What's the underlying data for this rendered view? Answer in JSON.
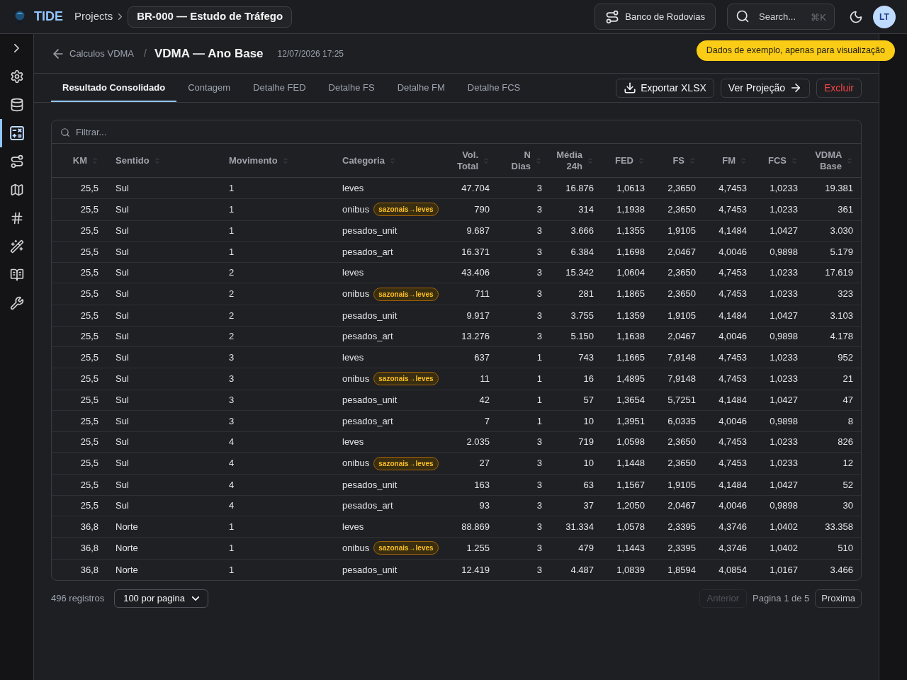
{
  "app": {
    "name": "TIDE"
  },
  "breadcrumb": {
    "root": "Projects",
    "project": "BR-000 — Estudo de Tráfego"
  },
  "top_actions": {
    "database_button": "Banco de Rodovias",
    "search": {
      "placeholder": "Search...",
      "shortcut": "⌘K"
    },
    "avatar": "LT"
  },
  "sidebar": {
    "items": [
      {
        "kind": "settings",
        "selected": false
      },
      {
        "kind": "database",
        "selected": false
      },
      {
        "kind": "calculator",
        "selected": true
      },
      {
        "kind": "route",
        "selected": false
      },
      {
        "kind": "map",
        "selected": false
      },
      {
        "kind": "hash",
        "selected": false
      },
      {
        "kind": "wand",
        "selected": false
      },
      {
        "kind": "book",
        "selected": false
      },
      {
        "kind": "wrench",
        "selected": false
      }
    ]
  },
  "page_header": {
    "back_link": "Calculos VDMA",
    "separator": "/",
    "title": "VDMA — Ano Base",
    "timestamp": "12/07/2026 17:25"
  },
  "notice": "Dados de exemplo, apenas para visualização",
  "tabs": [
    {
      "label": "Resultado Consolidado",
      "selected": true
    },
    {
      "label": "Contagem",
      "selected": false
    },
    {
      "label": "Detalhe FED",
      "selected": false
    },
    {
      "label": "Detalhe FS",
      "selected": false
    },
    {
      "label": "Detalhe FM",
      "selected": false
    },
    {
      "label": "Detalhe FCS",
      "selected": false
    }
  ],
  "actions": [
    {
      "label": "Exportar XLSX",
      "kind": "export"
    },
    {
      "label": "Ver Projeção",
      "kind": "navigate"
    },
    {
      "label": "Excluir",
      "kind": "danger"
    }
  ],
  "table": {
    "filter_placeholder": "Filtrar...",
    "columns": [
      "KM",
      "Sentido",
      "Movimento",
      "Categoria",
      "Vol. Total",
      "N Dias",
      "Média 24h",
      "FED",
      "FS",
      "FM",
      "FCS",
      "VDMA Base"
    ],
    "rows": [
      {
        "km": "25,5",
        "sentido": "Sul",
        "movimento": "1",
        "categoria": "leves",
        "vol_total": "47.704",
        "n_dias": "3",
        "media_24h": "16.876",
        "fed": "1,0613",
        "fs": "2,3650",
        "fm": "4,7453",
        "fcs": "1,0233",
        "vdma_base": "19.381"
      },
      {
        "km": "25,5",
        "sentido": "Sul",
        "movimento": "1",
        "categoria": "onibus",
        "tag": "sazonais→leves",
        "vol_total": "790",
        "n_dias": "3",
        "media_24h": "314",
        "fed": "1,1938",
        "fs": "2,3650",
        "fm": "4,7453",
        "fcs": "1,0233",
        "vdma_base": "361"
      },
      {
        "km": "25,5",
        "sentido": "Sul",
        "movimento": "1",
        "categoria": "pesados_unit",
        "vol_total": "9.687",
        "n_dias": "3",
        "media_24h": "3.666",
        "fed": "1,1355",
        "fs": "1,9105",
        "fm": "4,1484",
        "fcs": "1,0427",
        "vdma_base": "3.030"
      },
      {
        "km": "25,5",
        "sentido": "Sul",
        "movimento": "1",
        "categoria": "pesados_art",
        "vol_total": "16.371",
        "n_dias": "3",
        "media_24h": "6.384",
        "fed": "1,1698",
        "fs": "2,0467",
        "fm": "4,0046",
        "fcs": "0,9898",
        "vdma_base": "5.179"
      },
      {
        "km": "25,5",
        "sentido": "Sul",
        "movimento": "2",
        "categoria": "leves",
        "vol_total": "43.406",
        "n_dias": "3",
        "media_24h": "15.342",
        "fed": "1,0604",
        "fs": "2,3650",
        "fm": "4,7453",
        "fcs": "1,0233",
        "vdma_base": "17.619"
      },
      {
        "km": "25,5",
        "sentido": "Sul",
        "movimento": "2",
        "categoria": "onibus",
        "tag": "sazonais→leves",
        "vol_total": "711",
        "n_dias": "3",
        "media_24h": "281",
        "fed": "1,1865",
        "fs": "2,3650",
        "fm": "4,7453",
        "fcs": "1,0233",
        "vdma_base": "323"
      },
      {
        "km": "25,5",
        "sentido": "Sul",
        "movimento": "2",
        "categoria": "pesados_unit",
        "vol_total": "9.917",
        "n_dias": "3",
        "media_24h": "3.755",
        "fed": "1,1359",
        "fs": "1,9105",
        "fm": "4,1484",
        "fcs": "1,0427",
        "vdma_base": "3.103"
      },
      {
        "km": "25,5",
        "sentido": "Sul",
        "movimento": "2",
        "categoria": "pesados_art",
        "vol_total": "13.276",
        "n_dias": "3",
        "media_24h": "5.150",
        "fed": "1,1638",
        "fs": "2,0467",
        "fm": "4,0046",
        "fcs": "0,9898",
        "vdma_base": "4.178"
      },
      {
        "km": "25,5",
        "sentido": "Sul",
        "movimento": "3",
        "categoria": "leves",
        "vol_total": "637",
        "n_dias": "1",
        "media_24h": "743",
        "fed": "1,1665",
        "fs": "7,9148",
        "fm": "4,7453",
        "fcs": "1,0233",
        "vdma_base": "952"
      },
      {
        "km": "25,5",
        "sentido": "Sul",
        "movimento": "3",
        "categoria": "onibus",
        "tag": "sazonais→leves",
        "vol_total": "11",
        "n_dias": "1",
        "media_24h": "16",
        "fed": "1,4895",
        "fs": "7,9148",
        "fm": "4,7453",
        "fcs": "1,0233",
        "vdma_base": "21"
      },
      {
        "km": "25,5",
        "sentido": "Sul",
        "movimento": "3",
        "categoria": "pesados_unit",
        "vol_total": "42",
        "n_dias": "1",
        "media_24h": "57",
        "fed": "1,3654",
        "fs": "5,7251",
        "fm": "4,1484",
        "fcs": "1,0427",
        "vdma_base": "47"
      },
      {
        "km": "25,5",
        "sentido": "Sul",
        "movimento": "3",
        "categoria": "pesados_art",
        "vol_total": "7",
        "n_dias": "1",
        "media_24h": "10",
        "fed": "1,3951",
        "fs": "6,0335",
        "fm": "4,0046",
        "fcs": "0,9898",
        "vdma_base": "8"
      },
      {
        "km": "25,5",
        "sentido": "Sul",
        "movimento": "4",
        "categoria": "leves",
        "vol_total": "2.035",
        "n_dias": "3",
        "media_24h": "719",
        "fed": "1,0598",
        "fs": "2,3650",
        "fm": "4,7453",
        "fcs": "1,0233",
        "vdma_base": "826"
      },
      {
        "km": "25,5",
        "sentido": "Sul",
        "movimento": "4",
        "categoria": "onibus",
        "tag": "sazonais→leves",
        "vol_total": "27",
        "n_dias": "3",
        "media_24h": "10",
        "fed": "1,1448",
        "fs": "2,3650",
        "fm": "4,7453",
        "fcs": "1,0233",
        "vdma_base": "12"
      },
      {
        "km": "25,5",
        "sentido": "Sul",
        "movimento": "4",
        "categoria": "pesados_unit",
        "vol_total": "163",
        "n_dias": "3",
        "media_24h": "63",
        "fed": "1,1567",
        "fs": "1,9105",
        "fm": "4,1484",
        "fcs": "1,0427",
        "vdma_base": "52"
      },
      {
        "km": "25,5",
        "sentido": "Sul",
        "movimento": "4",
        "categoria": "pesados_art",
        "vol_total": "93",
        "n_dias": "3",
        "media_24h": "37",
        "fed": "1,2050",
        "fs": "2,0467",
        "fm": "4,0046",
        "fcs": "0,9898",
        "vdma_base": "30"
      },
      {
        "km": "36,8",
        "sentido": "Norte",
        "movimento": "1",
        "categoria": "leves",
        "vol_total": "88.869",
        "n_dias": "3",
        "media_24h": "31.334",
        "fed": "1,0578",
        "fs": "2,3395",
        "fm": "4,3746",
        "fcs": "1,0402",
        "vdma_base": "33.358"
      },
      {
        "km": "36,8",
        "sentido": "Norte",
        "movimento": "1",
        "categoria": "onibus",
        "tag": "sazonais→leves",
        "vol_total": "1.255",
        "n_dias": "3",
        "media_24h": "479",
        "fed": "1,1443",
        "fs": "2,3395",
        "fm": "4,3746",
        "fcs": "1,0402",
        "vdma_base": "510"
      },
      {
        "km": "36,8",
        "sentido": "Norte",
        "movimento": "1",
        "categoria": "pesados_unit",
        "vol_total": "12.419",
        "n_dias": "3",
        "media_24h": "4.487",
        "fed": "1,0839",
        "fs": "1,8594",
        "fm": "4,0854",
        "fcs": "1,0167",
        "vdma_base": "3.466"
      }
    ]
  },
  "footer": {
    "count": "496 registros",
    "page_size": "100 por pagina",
    "previous": {
      "label": "Anterior",
      "disabled": true
    },
    "page_info": "Pagina 1 de 5",
    "next": {
      "label": "Proxima",
      "disabled": false
    }
  }
}
